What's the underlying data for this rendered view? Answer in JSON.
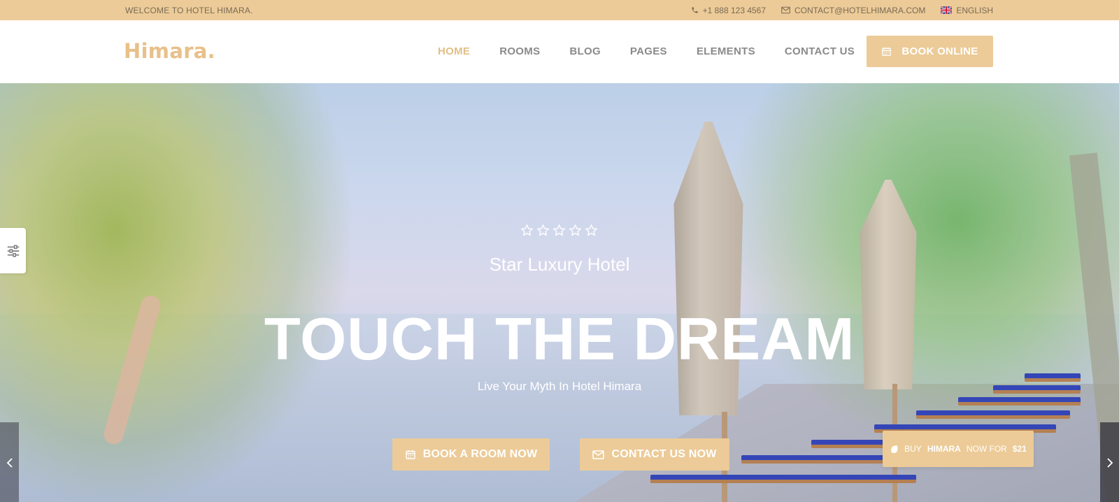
{
  "topbar": {
    "welcome": "WELCOME TO HOTEL HIMARA.",
    "phone": "+1 888 123 4567",
    "email": "CONTACT@HOTELHIMARA.COM",
    "language": "ENGLISH"
  },
  "header": {
    "logo": "Himara.",
    "nav": [
      "HOME",
      "ROOMS",
      "BLOG",
      "PAGES",
      "ELEMENTS",
      "CONTACT US"
    ],
    "active_nav": "HOME",
    "book_online": "BOOK ONLINE"
  },
  "hero": {
    "star_count": 5,
    "subtitle": "Star Luxury Hotel",
    "headline": "TOUCH THE DREAM",
    "tagline": "Live Your Myth In Hotel Himara",
    "book_button": "BOOK A ROOM NOW",
    "contact_button": "CONTACT US NOW"
  },
  "promo": {
    "prefix": "BUY",
    "brand": "HIMARA",
    "middle": "NOW FOR",
    "price": "$21"
  },
  "icons": {
    "phone": "phone-icon",
    "email": "envelope-icon",
    "language": "uk-flag-icon",
    "calendar": "calendar-icon",
    "settings": "sliders-icon",
    "promo": "leaf-icon",
    "prev": "chevron-left-icon",
    "next": "chevron-right-icon"
  },
  "colors": {
    "accent": "#eccb98",
    "logo": "#e8c08a",
    "nav_text": "#8a8a8a",
    "active_nav": "#e2bf86"
  }
}
